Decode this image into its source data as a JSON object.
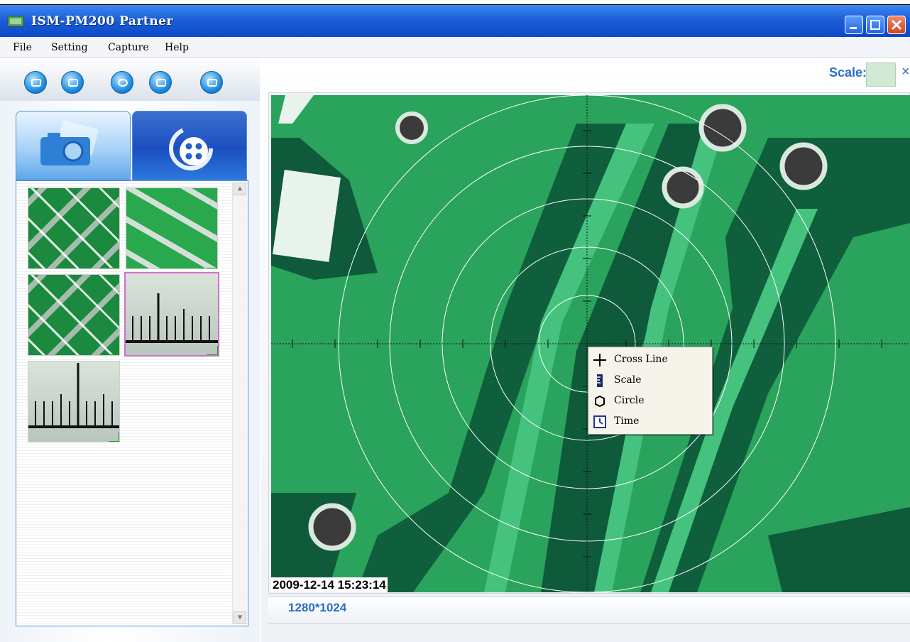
{
  "window": {
    "title": "ISM-PM200 Partner"
  },
  "menu": [
    "File",
    "Setting",
    "Capture",
    "Help"
  ],
  "toolbar": {
    "buttons": [
      "snapshot-icon",
      "record-icon",
      "measure-icon",
      "mail-icon",
      "save-icon"
    ]
  },
  "tabs": {
    "photo": "photo-tab",
    "video": "video-tab"
  },
  "thumbnails": [
    {
      "kind": "pcb",
      "selected": false
    },
    {
      "kind": "pcb",
      "selected": false
    },
    {
      "kind": "pcb",
      "selected": false
    },
    {
      "kind": "ruler",
      "selected": true
    },
    {
      "kind": "ruler",
      "selected": false
    }
  ],
  "scale": {
    "label": "Scale:",
    "close": "×"
  },
  "viewer": {
    "timestamp": "2009-12-14 15:23:14",
    "resolution": "1280*1024"
  },
  "context_menu": {
    "items": [
      {
        "label": "Cross Line",
        "icon": "crosshair-icon"
      },
      {
        "label": "Scale",
        "icon": "ruler-icon"
      },
      {
        "label": "Circle",
        "icon": "circle-icon"
      },
      {
        "label": "Time",
        "icon": "clock-icon"
      }
    ]
  },
  "colors": {
    "title_bar": "#1c5fd9",
    "accent": "#2a6fc5",
    "pcb_green": "#2aa35c"
  }
}
